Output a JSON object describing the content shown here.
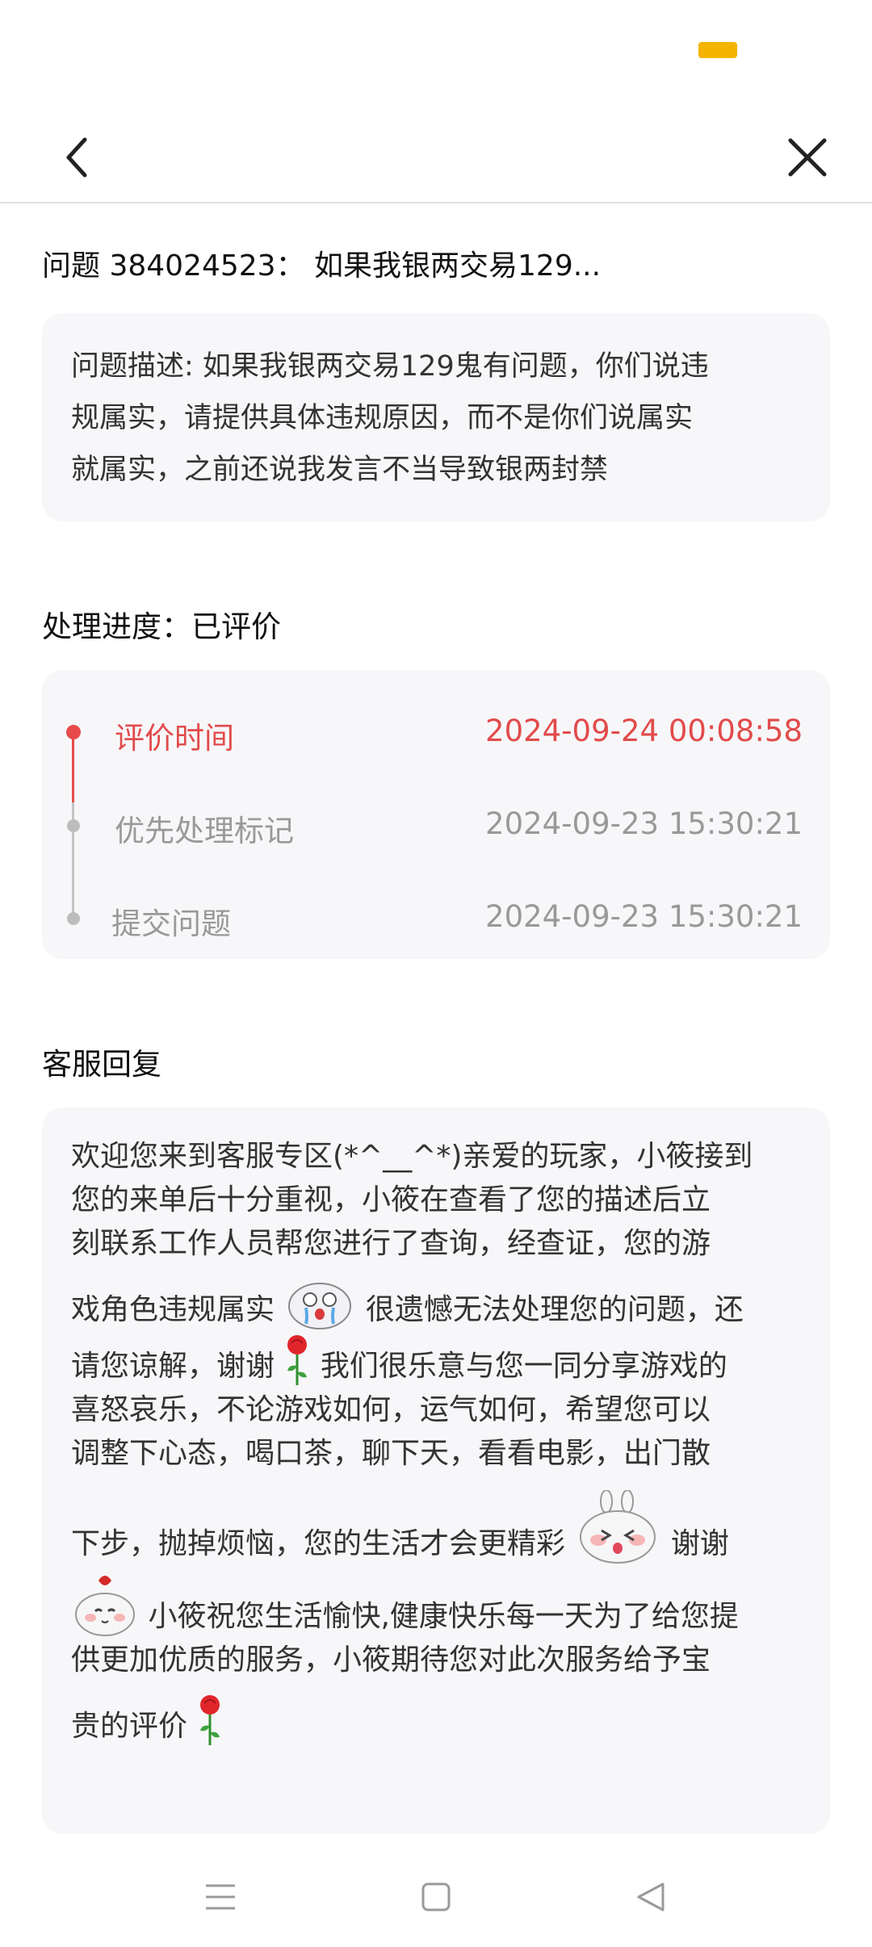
{
  "question": {
    "title": "问题 384024523：  如果我银两交易129...",
    "description_lines": [
      "问题描述: 如果我银两交易129鬼有问题，你们说违",
      "规属实，请提供具体违规原因，而不是你们说属实",
      "就属实，之前还说我发言不当导致银两封禁"
    ]
  },
  "progress": {
    "title": "处理进度：已评价",
    "steps": [
      {
        "label": "评价时间",
        "time": "2024-09-24 00:08:58",
        "active": true
      },
      {
        "label": "优先处理标记",
        "time": "2024-09-23 15:30:21",
        "active": false
      },
      {
        "label": "提交问题",
        "time": "2024-09-23 15:30:21",
        "active": false
      }
    ]
  },
  "reply": {
    "title": "客服回复",
    "line1": "欢迎您来到客服专区(*^__^*)亲爱的玩家，小筱接到",
    "line2": "您的来单后十分重视，小筱在查看了您的描述后立",
    "line3": "刻联系工作人员帮您进行了查询，经查证，您的游",
    "line4a": "戏角色违规属实",
    "line4b": "很遗憾无法处理您的问题，还",
    "line5a": "请您谅解，谢谢",
    "line5b": "我们很乐意与您一同分享游戏的",
    "line6": "喜怒哀乐，不论游戏如何，运气如何，希望您可以",
    "line7": "调整下心态，喝口茶，聊下天，看看电影，出门散",
    "line8a": "下步，抛掉烦恼，您的生活才会更精彩",
    "line8b": "谢谢",
    "line9": "小筱祝您生活愉快,健康快乐每一天为了给您提",
    "line10": "供更加优质的服务，小筱期待您对此次服务给予宝",
    "line11": "贵的评价"
  },
  "icons": {
    "back": "chevron-left-icon",
    "close": "close-icon",
    "nav_menu": "menu-icon",
    "nav_home": "square-icon",
    "nav_back": "triangle-back-icon"
  },
  "colors": {
    "accent_red": "#e84a4a",
    "status_yellow": "#f5b400",
    "muted": "#999999",
    "card_bg": "#f7f7f9"
  }
}
